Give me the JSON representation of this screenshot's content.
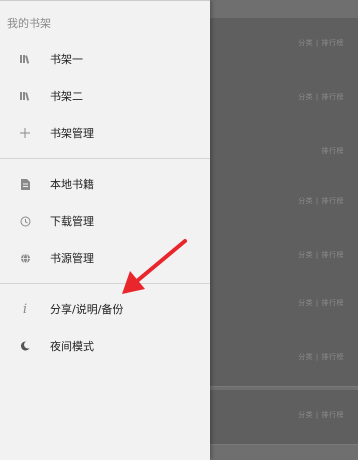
{
  "background_list": {
    "rows": [
      {
        "text": "分类 | 排行榜"
      },
      {
        "text": "分类 | 排行榜"
      },
      {
        "text": "排行榜"
      },
      {
        "text": "分类 | 排行榜"
      },
      {
        "text": "分类 | 排行榜"
      },
      {
        "text": "分类 | 排行榜"
      },
      {
        "text": "分类 | 排行榜"
      },
      {
        "text": "分类 | 排行榜"
      }
    ]
  },
  "drawer": {
    "header": "我的书架",
    "items": [
      {
        "label": "书架一",
        "icon": "books-icon"
      },
      {
        "label": "书架二",
        "icon": "books-icon"
      },
      {
        "label": "书架管理",
        "icon": "plus-icon"
      },
      {
        "label": "本地书籍",
        "icon": "document-icon"
      },
      {
        "label": "下载管理",
        "icon": "history-icon"
      },
      {
        "label": "书源管理",
        "icon": "globe-icon"
      },
      {
        "label": "分享/说明/备份",
        "icon": "info-icon"
      },
      {
        "label": "夜间模式",
        "icon": "moon-icon"
      }
    ]
  },
  "colors": {
    "drawer_bg": "#f2f2f2",
    "scrim": "#6f6f6f",
    "arrow": "#e8262b",
    "icon": "#8a8a8a"
  }
}
